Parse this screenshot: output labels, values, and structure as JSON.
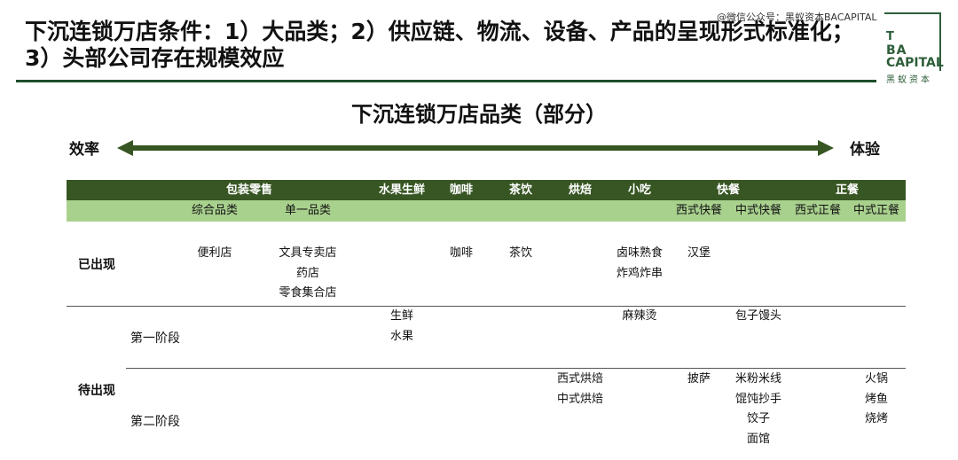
{
  "title": "下沉连锁万店条件：1）大品类；2）供应链、物流、设备、产品的呈现形式标准化；3）头部公司存在规模效应",
  "watermark": "@微信公众号：黑蚁资本BACAPITAL",
  "logo": {
    "line1": "T",
    "line2": "BA",
    "line3": "CAPITAL",
    "chinese": "黑蚁资本"
  },
  "subtitle": "下沉连锁万店品类（部分）",
  "axis": {
    "left": "效率",
    "right": "体验"
  },
  "colors": {
    "brand_green": "#1f4e2c",
    "header_dark": "#375623",
    "header_light": "#a9d18e"
  },
  "header": {
    "categories": [
      "包装零售",
      "水果生鲜",
      "咖啡",
      "茶饮",
      "烘焙",
      "小吃",
      "快餐",
      "正餐"
    ],
    "subcategories": [
      "综合品类",
      "单一品类",
      "西式快餐",
      "中式快餐",
      "西式正餐",
      "中式正餐"
    ]
  },
  "rows": {
    "existing": {
      "label": "已出现",
      "cells": {
        "zonghe": [
          "便利店"
        ],
        "danyi": [
          "文具专卖店",
          "药店",
          "零食集合店"
        ],
        "kafei": [
          "咖啡"
        ],
        "chayin": [
          "茶饮"
        ],
        "xiaochi": [
          "卤味熟食",
          "炸鸡炸串"
        ],
        "xishi_kuaican": [
          "汉堡"
        ]
      }
    },
    "pending": {
      "label": "待出现",
      "stage1": {
        "label": "第一阶段",
        "cells": {
          "shuiguo": [
            "生鲜",
            "水果"
          ],
          "xiaochi": [
            "麻辣烫"
          ],
          "zhongshi_kuaican": [
            "包子馒头"
          ]
        }
      },
      "stage2": {
        "label": "第二阶段",
        "cells": {
          "hongbei": [
            "西式烘焙",
            "中式烘焙"
          ],
          "xishi_kuaican": [
            "披萨"
          ],
          "zhongshi_kuaican": [
            "米粉米线",
            "馄饨抄手",
            "饺子",
            "面馆"
          ],
          "zhongshi_zhengcan": [
            "火锅",
            "烤鱼",
            "烧烤"
          ]
        }
      }
    }
  }
}
